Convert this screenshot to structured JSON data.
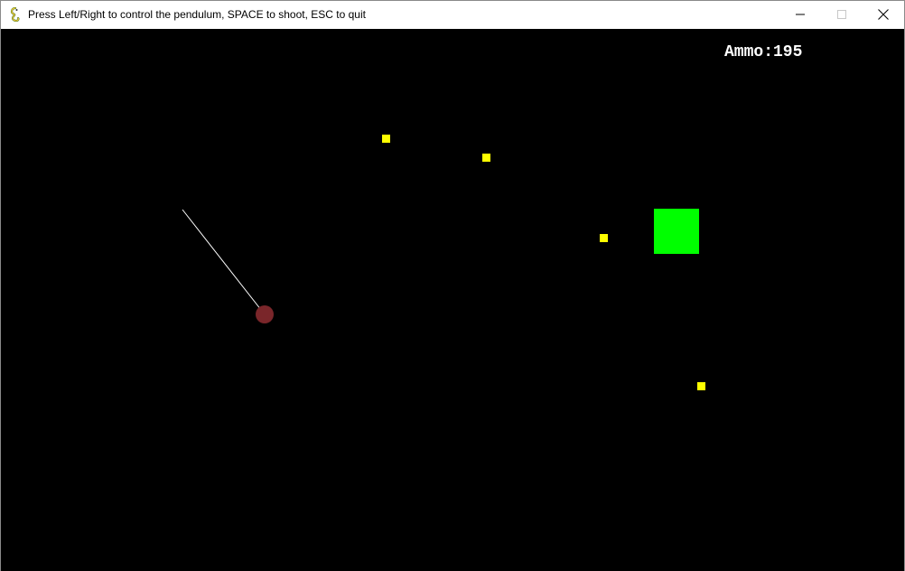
{
  "window": {
    "title": "Press Left/Right to control the pendulum, SPACE to shoot, ESC to quit",
    "app_icon": "pygame-snake-icon",
    "controls": [
      "minimize-icon",
      "maximize-icon",
      "close-icon"
    ]
  },
  "hud": {
    "ammo_text": "Ammo:195",
    "ammo_value": 195
  },
  "colors": {
    "background": "#000000",
    "rope": "#ffffff",
    "bob": "#7a262a",
    "bullet": "#ffff00",
    "target": "#00ff00",
    "hud_text": "#ffffff"
  }
}
